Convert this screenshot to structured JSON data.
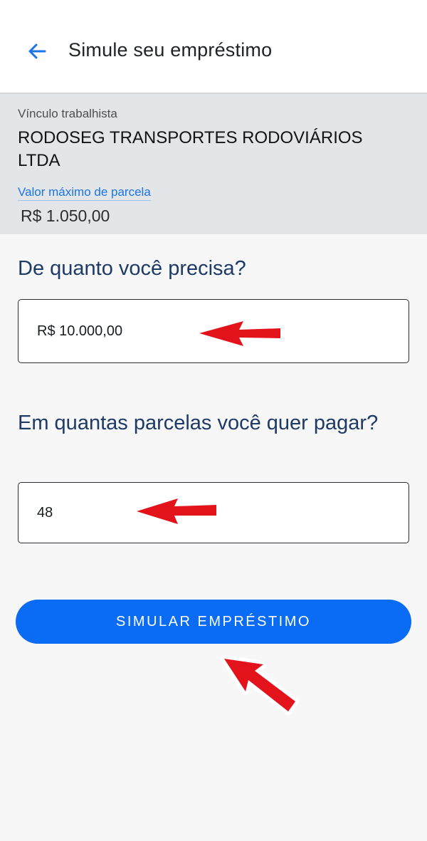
{
  "header": {
    "back_icon": "arrow-left-icon",
    "title": "Simule seu empréstimo"
  },
  "employment": {
    "label": "Vínculo trabalhista",
    "employer": "RODOSEG TRANSPORTES RODOVIÁRIOS LTDA",
    "max_installment_link": "Valor máximo de parcela",
    "max_installment_value": "R$ 1.050,00"
  },
  "form": {
    "amount_question": "De quanto você precisa?",
    "amount_value": "R$ 10.000,00",
    "installments_question": "Em quantas parcelas você quer pagar?",
    "installments_value": "48",
    "submit_label": "SIMULAR EMPRÉSTIMO"
  },
  "colors": {
    "accent": "#0a6cf5",
    "link": "#1a73e8",
    "question_text": "#1e3a66",
    "annotation_arrow": "#e3131b"
  }
}
